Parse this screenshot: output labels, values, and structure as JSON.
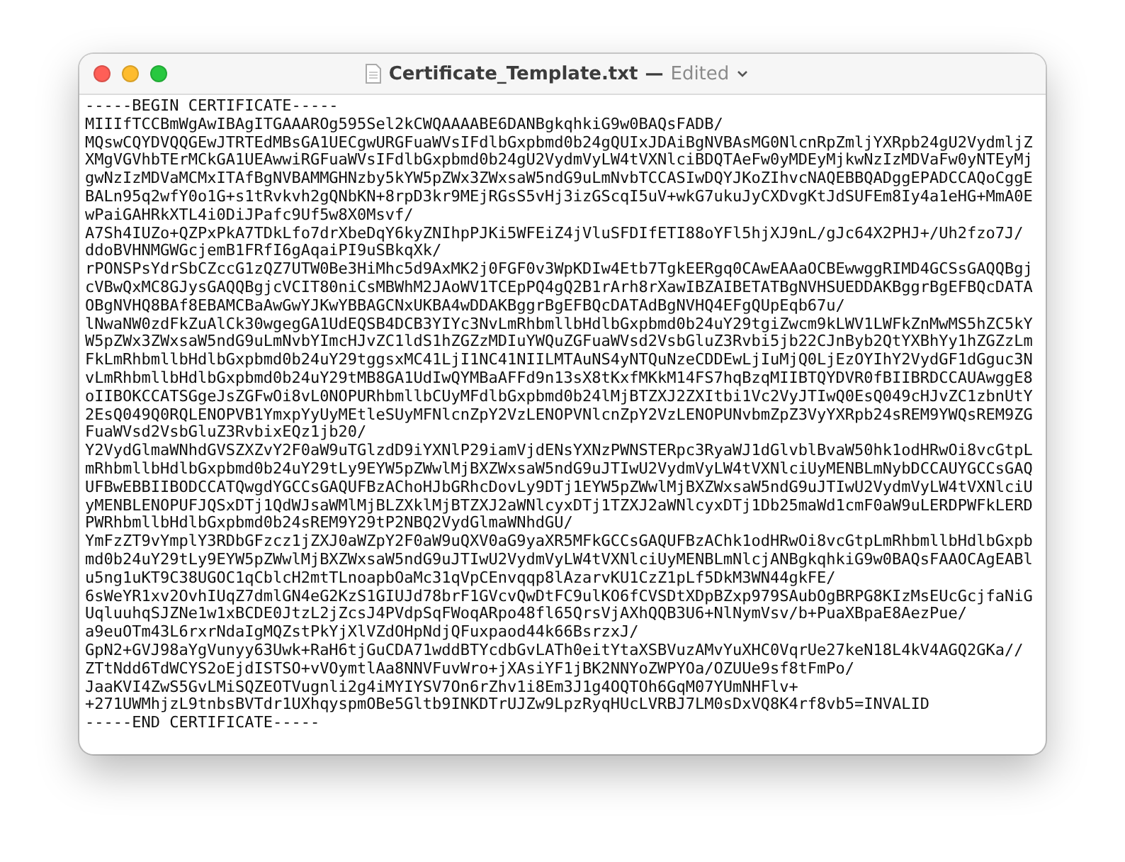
{
  "window": {
    "title": "Certificate_Template.txt",
    "separator": "—",
    "status": "Edited"
  },
  "document": {
    "lines": [
      "-----BEGIN CERTIFICATE-----",
      "MIIIfTCCBmWgAwIBAgITGAAAROg595Sel2kCWQAAAABE6DANBgkqhkiG9w0BAQsFADB/",
      "MQswCQYDVQQGEwJTRTEdMBsGA1UECgwURGFuaWVsIFdlbGxpbmd0b24gQUIxJDAiBgNVBAsMG0NlcnRpZmljYXRpb24gU2VydmljZ",
      "XMgVGVhbTErMCkGA1UEAwwiRGFuaWVsIFdlbGxpbmd0b24gU2VydmVyLW4tVXNlciBDQTAeFw0yMDEyMjkwNzIzMDVaFw0yNTEyMj",
      "gwNzIzMDVaMCMxITAfBgNVBAMMGHNzby5kYW5pZWx3ZWxsaW5ndG9uLmNvbTCCASIwDQYJKoZIhvcNAQEBBQADggEPADCCAQoCggE",
      "BALn95q2wfY0o1G+s1tRvkvh2gQNbKN+8rpD3kr9MEjRGsS5vHj3izGScqI5uV+wkG7ukuJyCXDvgKtJdSUFEm8Iy4a1eHG+MmA0E",
      "wPaiGAHRkXTL4i0DiJPafc9Uf5w8X0Msvf/",
      "A7Sh4IUZo+QZPxPkA7TDkLfo7drXbeDqY6kyZNIhpPJKi5WFEiZ4jVluSFDIfETI88oYFl5hjXJ9nL/gJc64X2PHJ+/Uh2fzo7J/",
      "ddoBVHNMGWGcjemB1FRfI6gAqaiPI9uSBkqXk/",
      "rPONSPsYdrSbCZccG1zQZ7UTW0Be3HiMhc5d9AxMK2j0FGF0v3WpKDIw4Etb7TgkEERgq0CAwEAAaOCBEwwggRIMD4GCSsGAQQBgj",
      "cVBwQxMC8GJysGAQQBgjcVCIT80niCsMBWhM2JAoWV1TCEpPQ4gQ2B1rArh8rXawIBZAIBETATBgNVHSUEDDAKBggrBgEFBQcDATA",
      "OBgNVHQ8BAf8EBAMCBaAwGwYJKwYBBAGCNxUKBA4wDDAKBggrBgEFBQcDATAdBgNVHQ4EFgQUpEqb67u/",
      "lNwaNW0zdFkZuAlCk30wgegGA1UdEQSB4DCB3YIYc3NvLmRhbmllbHdlbGxpbmd0b24uY29tgiZwcm9kLWV1LWFkZnMwMS5hZC5kY",
      "W5pZWx3ZWxsaW5ndG9uLmNvbYImcHJvZC1ldS1hZGZzMDIuYWQuZGFuaWVsd2VsbGluZ3Rvbi5jb22CJnByb2QtYXBhYy1hZGZzLm",
      "FkLmRhbmllbHdlbGxpbmd0b24uY29tggsxMC41LjI1NC41NIILMTAuNS4yNTQuNzeCDDEwLjIuMjQ0LjEzOYIhY2VydGF1dGguc3N",
      "vLmRhbmllbHdlbGxpbmd0b24uY29tMB8GA1UdIwQYMBaAFFd9n13sX8tKxfMKkM14FS7hqBzqMIIBTQYDVR0fBIIBRDCCAUAwggE8",
      "oIIBOKCCATSGgeJsZGFwOi8vL0NOPURhbmllbCUyMFdlbGxpbmd0b24lMjBTZXJ2ZXItbi1Vc2VyJTIwQ0EsQ049cHJvZC1zbnUtY",
      "2EsQ049Q0RQLENOPVB1YmxpYyUyMEtleSUyMFNlcnZpY2VzLENOPVNlcnZpY2VzLENOPUNvbmZpZ3VyYXRpb24sREM9YWQsREM9ZG",
      "FuaWVsd2VsbGluZ3RvbixEQz1jb20/",
      "Y2VydGlmaWNhdGVSZXZvY2F0aW9uTGlzdD9iYXNlP29iamVjdENsYXNzPWNSTERpc3RyaWJ1dGlvblBvaW50hk1odHRwOi8vcGtpL",
      "mRhbmllbHdlbGxpbmd0b24uY29tLy9EYW5pZWwlMjBXZWxsaW5ndG9uJTIwU2VydmVyLW4tVXNlciUyMENBLmNybDCCAUYGCCsGAQ",
      "UFBwEBBIIBODCCATQwgdYGCCsGAQUFBzAChoHJbGRhcDovLy9DTj1EYW5pZWwlMjBXZWxsaW5ndG9uJTIwU2VydmVyLW4tVXNlciU",
      "yMENBLENOPUFJQSxDTj1QdWJsaWMlMjBLZXklMjBTZXJ2aWNlcyxDTj1TZXJ2aWNlcyxDTj1Db25maWd1cmF0aW9uLERDPWFkLERD",
      "PWRhbmllbHdlbGxpbmd0b24sREM9Y29tP2NBQ2VydGlmaWNhdGU/",
      "YmFzZT9vYmplY3RDbGFzcz1jZXJ0aWZpY2F0aW9uQXV0aG9yaXR5MFkGCCsGAQUFBzAChk1odHRwOi8vcGtpLmRhbmllbHdlbGxpb",
      "md0b24uY29tLy9EYW5pZWwlMjBXZWxsaW5ndG9uJTIwU2VydmVyLW4tVXNlciUyMENBLmNlcjANBgkqhkiG9w0BAQsFAAOCAgEABl",
      "u5ng1uKT9C38UGOC1qCblcH2mtTLnoapbOaMc31qVpCEnvqqp8lAzarvKU1CzZ1pLf5DkM3WN44gkFE/",
      "6sWeYR1xv2OvhIUqZ7dmlGN4eG2KzS1GIUJd78brF1GVcvQwDtFC9ulKO6fCVSDtXDpBZxp979SAubOgBRPG8KIzMsEUcGcjfaNiG",
      "UqluuhqSJZNe1w1xBCDE0JtzL2jZcsJ4PVdpSqFWoqARpo48fl65QrsVjAXhQQB3U6+NlNymVsv/b+PuaXBpaE8AezPue/",
      "a9euOTm43L6rxrNdaIgMQZstPkYjXlVZdOHpNdjQFuxpaod44k66BsrzxJ/",
      "GpN2+GVJ98aYgVunyy63Uwk+RaH6tjGuCDA71wddBTYcdbGvLATh0eitYtaXSBVuzAMvYuXHC0VqrUe27keN18L4kV4AGQ2GKa//",
      "ZTtNdd6TdWCYS2oEjdISTSO+vVOymtlAa8NNVFuvWro+jXAsiYF1jBK2NNYoZWPYOa/OZUUe9sf8tFmPo/",
      "JaaKVI4ZwS5GvLMiSQZEOTVugnli2g4iMYIYSV7On6rZhv1i8Em3J1g4OQTOh6GqM07YUmNHFlv+",
      "+271UWMhjzL9tnbsBVTdr1UXhqyspmOBe5Gltb9INKDTrUJZw9LpzRyqHUcLVRBJ7LM0sDxVQ8K4rf8vb5=INVALID",
      "-----END CERTIFICATE-----"
    ]
  }
}
